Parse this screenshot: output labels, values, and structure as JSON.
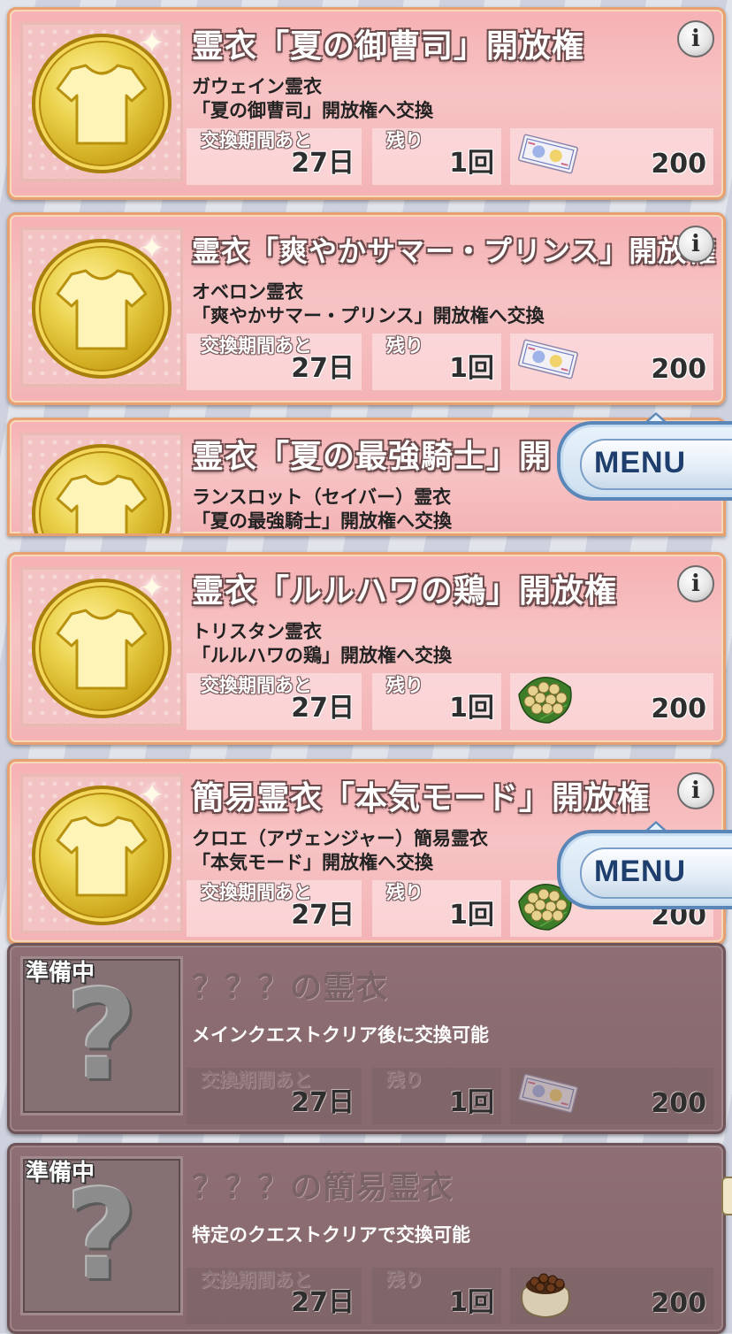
{
  "labels": {
    "period": "交換期間あと",
    "remaining": "残り",
    "preparing": "準備中",
    "menu": "MENU",
    "info": "i"
  },
  "items": [
    {
      "title": "霊衣「夏の御曹司」開放権",
      "desc1": "ガウェイン霊衣",
      "desc2": "「夏の御曹司」開放権へ交換",
      "period_value": "27日",
      "remaining_value": "1回",
      "cost": "200",
      "currency_icon": "ticket-icon"
    },
    {
      "title": "霊衣「爽やかサマー・プリンス」開放権",
      "desc1": "オベロン霊衣",
      "desc2": "「爽やかサマー・プリンス」開放権へ交換",
      "period_value": "27日",
      "remaining_value": "1回",
      "cost": "200",
      "currency_icon": "ticket-icon"
    },
    {
      "title": "霊衣「夏の最強騎士」開",
      "desc1": "ランスロット（セイバー）霊衣",
      "desc2": "「夏の最強騎士」開放権へ交換"
    },
    {
      "title": "霊衣「ルルハワの鶏」開放権",
      "desc1": "トリスタン霊衣",
      "desc2": "「ルルハワの鶏」開放権へ交換",
      "period_value": "27日",
      "remaining_value": "1回",
      "cost": "200",
      "currency_icon": "seeds-icon"
    },
    {
      "title": "簡易霊衣「本気モード」開放権",
      "desc1": "クロエ（アヴェンジャー）簡易霊衣",
      "desc2": "「本気モード」開放権へ交換",
      "period_value": "27日",
      "remaining_value": "1回",
      "cost": "200",
      "currency_icon": "seeds-icon"
    },
    {
      "title": "？？？の霊衣",
      "desc1": "メインクエストクリア後に交換可能",
      "period_value": "27日",
      "remaining_value": "1回",
      "cost": "200",
      "currency_icon": "ticket-icon",
      "locked": true
    },
    {
      "title": "？？？の簡易霊衣",
      "desc1": "特定のクエストクリアで交換可能",
      "period_value": "27日",
      "remaining_value": "1回",
      "cost": "200",
      "currency_icon": "bag-icon",
      "locked": true
    }
  ]
}
